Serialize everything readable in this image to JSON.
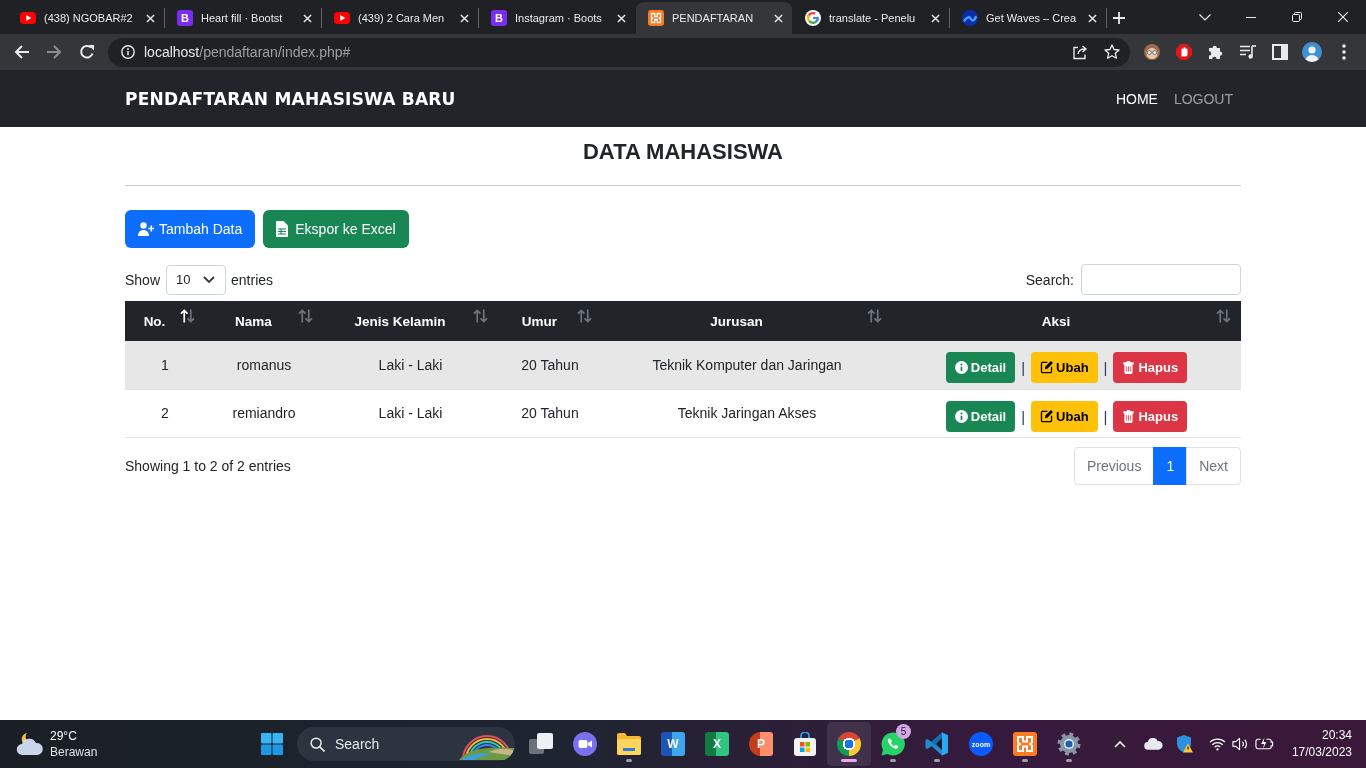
{
  "browser": {
    "tabs": [
      {
        "title": "(438) NGOBAR#2",
        "kind": "video",
        "selected": false
      },
      {
        "title": "Heart fill · Bootst",
        "kind": "letter",
        "glyph": "B",
        "selected": false
      },
      {
        "title": "(439) 2 Cara Men",
        "kind": "video",
        "selected": false
      },
      {
        "title": "Instagram · Boots",
        "kind": "letter",
        "glyph": "B",
        "selected": false
      },
      {
        "title": "PENDAFTARAN",
        "kind": "xampp",
        "selected": true
      },
      {
        "title": "translate - Penelu",
        "kind": "search",
        "selected": false
      },
      {
        "title": "Get Waves – Crea",
        "kind": "waves",
        "selected": false
      }
    ],
    "url": {
      "host": "localhost",
      "path": "/pendaftaran/index.php#"
    }
  },
  "navbar": {
    "brand": "PENDAFTARAN MAHASISWA BARU",
    "links": [
      {
        "label": "HOME",
        "selected": true
      },
      {
        "label": "LOGOUT",
        "selected": false
      }
    ]
  },
  "page": {
    "title": "DATA MAHASISWA",
    "buttons": [
      {
        "kind": "add",
        "label": "Tambah Data"
      },
      {
        "kind": "export",
        "label": "Ekspor ke Excel"
      }
    ]
  },
  "table_controls": {
    "show_label": "Show",
    "page_length": "10",
    "entries_label": "entries",
    "search_label": "Search:"
  },
  "table": {
    "columns": [
      {
        "label": "No.",
        "sorted": true
      },
      {
        "label": "Nama",
        "sorted": false
      },
      {
        "label": "Jenis Kelamin",
        "sorted": false
      },
      {
        "label": "Umur",
        "sorted": false
      },
      {
        "label": "Jurusan",
        "sorted": false
      },
      {
        "label": "Aksi",
        "sorted": false
      }
    ],
    "rows": [
      {
        "shaded": true,
        "cells": [
          "1",
          "romanus",
          "Laki - Laki",
          "20 Tahun",
          "Teknik Komputer dan Jaringan"
        ],
        "actions": [
          {
            "kind": "detail",
            "label": "Detail"
          },
          {
            "kind": "separator",
            "label": "|"
          },
          {
            "kind": "edit",
            "label": "Ubah"
          },
          {
            "kind": "separator",
            "label": "|"
          },
          {
            "kind": "delete",
            "label": "Hapus"
          }
        ]
      },
      {
        "shaded": false,
        "cells": [
          "2",
          "remiandro",
          "Laki - Laki",
          "20 Tahun",
          "Teknik Jaringan Akses"
        ],
        "actions": [
          {
            "kind": "detail",
            "label": "Detail"
          },
          {
            "kind": "separator",
            "label": "|"
          },
          {
            "kind": "edit",
            "label": "Ubah"
          },
          {
            "kind": "separator",
            "label": "|"
          },
          {
            "kind": "delete",
            "label": "Hapus"
          }
        ]
      }
    ]
  },
  "table_footer": {
    "info": "Showing 1 to 2 of 2 entries",
    "pagination": [
      {
        "label": "Previous",
        "selected": false,
        "disabled": true
      },
      {
        "label": "1",
        "selected": true,
        "disabled": false
      },
      {
        "label": "Next",
        "selected": false,
        "disabled": true
      }
    ]
  },
  "taskbar": {
    "weather": {
      "temperature": "29°C",
      "condition": "Berawan"
    },
    "search": {
      "label": "Search"
    },
    "apps": [
      {
        "kind": "task_view",
        "running": false,
        "active": false
      },
      {
        "kind": "chat",
        "running": false,
        "active": false
      },
      {
        "kind": "explorer",
        "running": true,
        "active": false
      },
      {
        "kind": "word",
        "glyph": "W",
        "running": false,
        "active": false
      },
      {
        "kind": "excel",
        "glyph": "X",
        "running": false,
        "active": false
      },
      {
        "kind": "powerpoint",
        "glyph": "P",
        "running": false,
        "active": false
      },
      {
        "kind": "store",
        "running": false,
        "active": false
      },
      {
        "kind": "chrome",
        "running": true,
        "active": true
      },
      {
        "kind": "whatsapp",
        "badge": "5",
        "running": true,
        "active": false
      },
      {
        "kind": "vscode",
        "running": true,
        "active": false
      },
      {
        "kind": "zoom",
        "glyph": "zoom",
        "running": false,
        "active": false
      },
      {
        "kind": "xampp",
        "running": true,
        "active": false
      },
      {
        "kind": "settings",
        "running": true,
        "active": false
      }
    ],
    "clock": {
      "time": "20:34",
      "date": "17/03/2023"
    }
  }
}
